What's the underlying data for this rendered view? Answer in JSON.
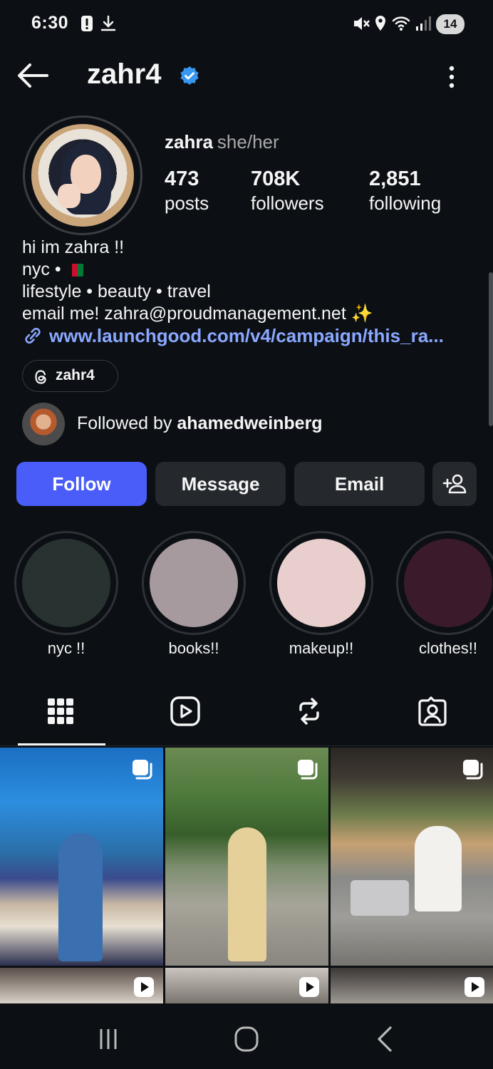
{
  "status_bar": {
    "time": "6:30",
    "battery": "14"
  },
  "header": {
    "username": "zahr4"
  },
  "profile": {
    "name": "zahra",
    "pronouns": "she/her",
    "stats": [
      {
        "value": "473",
        "label": "posts"
      },
      {
        "value": "708K",
        "label": "followers"
      },
      {
        "value": "2,851",
        "label": "following"
      }
    ],
    "bio": {
      "line1": "hi im zahra !!",
      "line2": "nyc •",
      "line3": "lifestyle • beauty • travel",
      "line4": "email me! zahra@proudmanagement.net",
      "line4_emoji": "✨"
    },
    "link": "www.launchgood.com/v4/campaign/this_ra...",
    "threads_handle": "zahr4",
    "followed_by_prefix": "Followed by",
    "followed_by_user": "ahamedweinberg"
  },
  "actions": {
    "follow": "Follow",
    "message": "Message",
    "email": "Email"
  },
  "highlights": [
    {
      "label": "nyc !!",
      "color": "#283230"
    },
    {
      "label": "books!!",
      "color": "#a69a9e"
    },
    {
      "label": "makeup!!",
      "color": "#e8cfcd"
    },
    {
      "label": "clothes!!",
      "color": "#3b1a2b"
    }
  ],
  "tabs": [
    "grid-tab",
    "reels-tab",
    "reposts-tab",
    "tagged-tab"
  ],
  "colors": {
    "accent": "#4a5df9",
    "link": "#8aa8ff",
    "background": "#0c1014",
    "verified": "#3897f0"
  }
}
